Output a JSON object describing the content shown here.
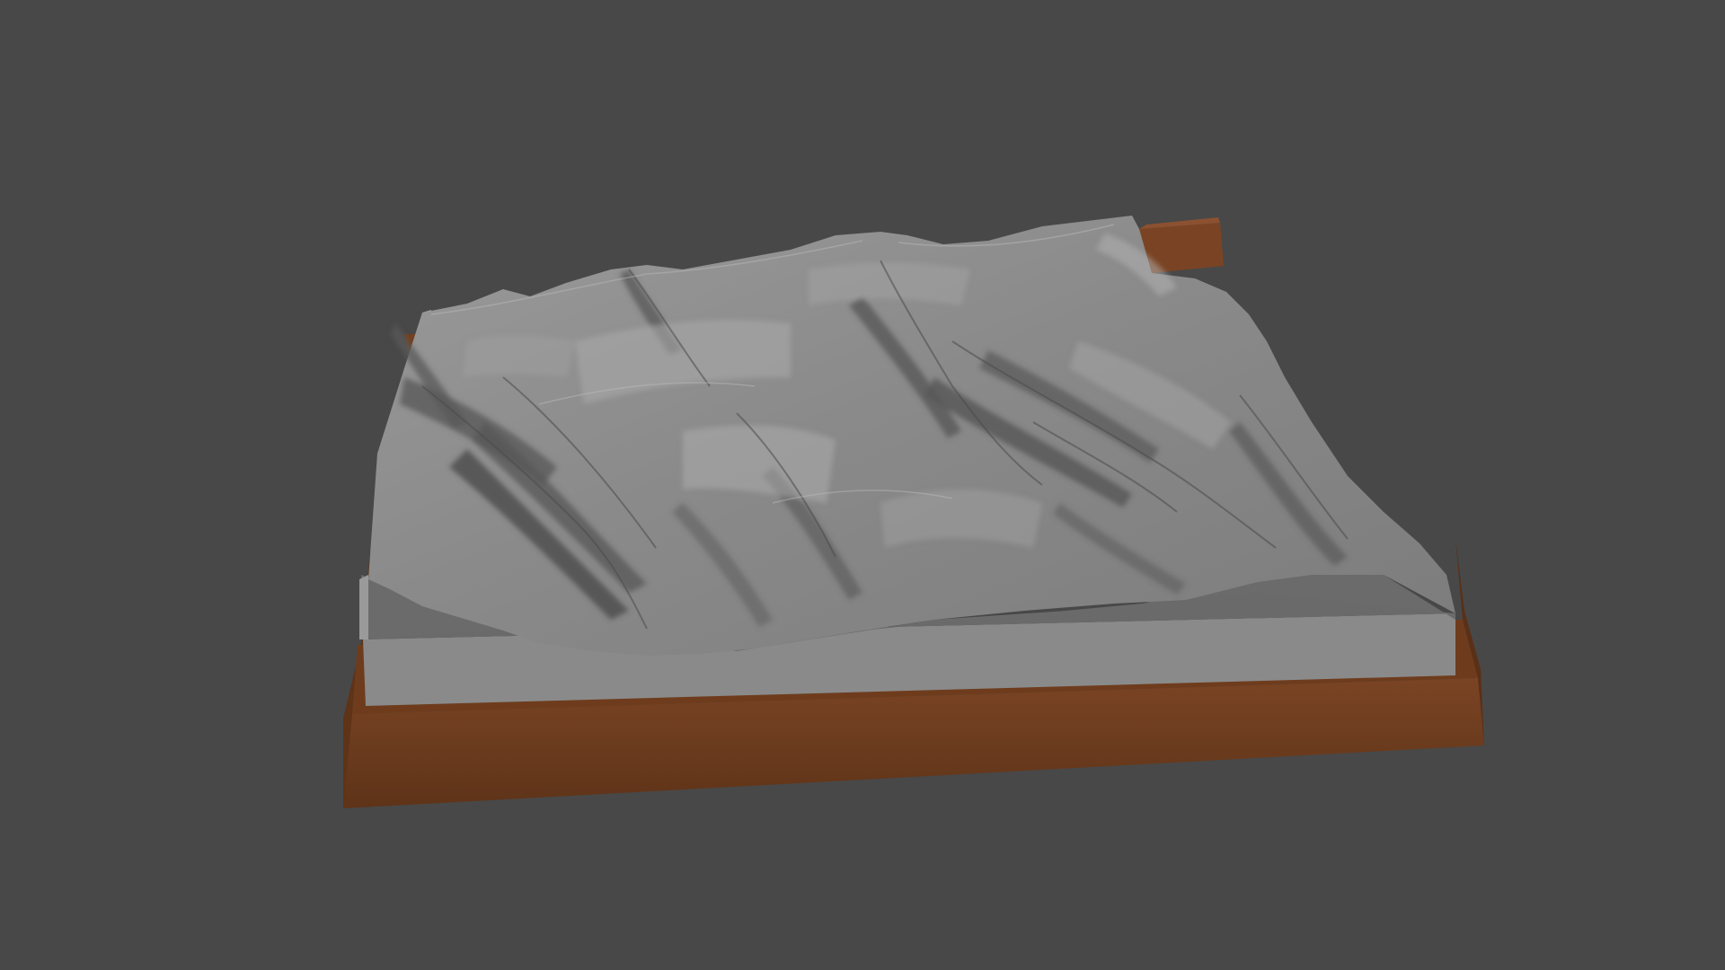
{
  "viewport": {
    "background_color": "#484848"
  },
  "model": {
    "kind": "terrain-relief-model",
    "terrain_color": "#8e8e8e",
    "terrain_shadow_color": "#5b5b5b",
    "terrain_highlight_color": "#b9b9b9",
    "base_top_color": "#666666",
    "base_side_color": "#888888",
    "frame_color": "#6b3b1d",
    "frame_top_color": "#7a4424"
  }
}
